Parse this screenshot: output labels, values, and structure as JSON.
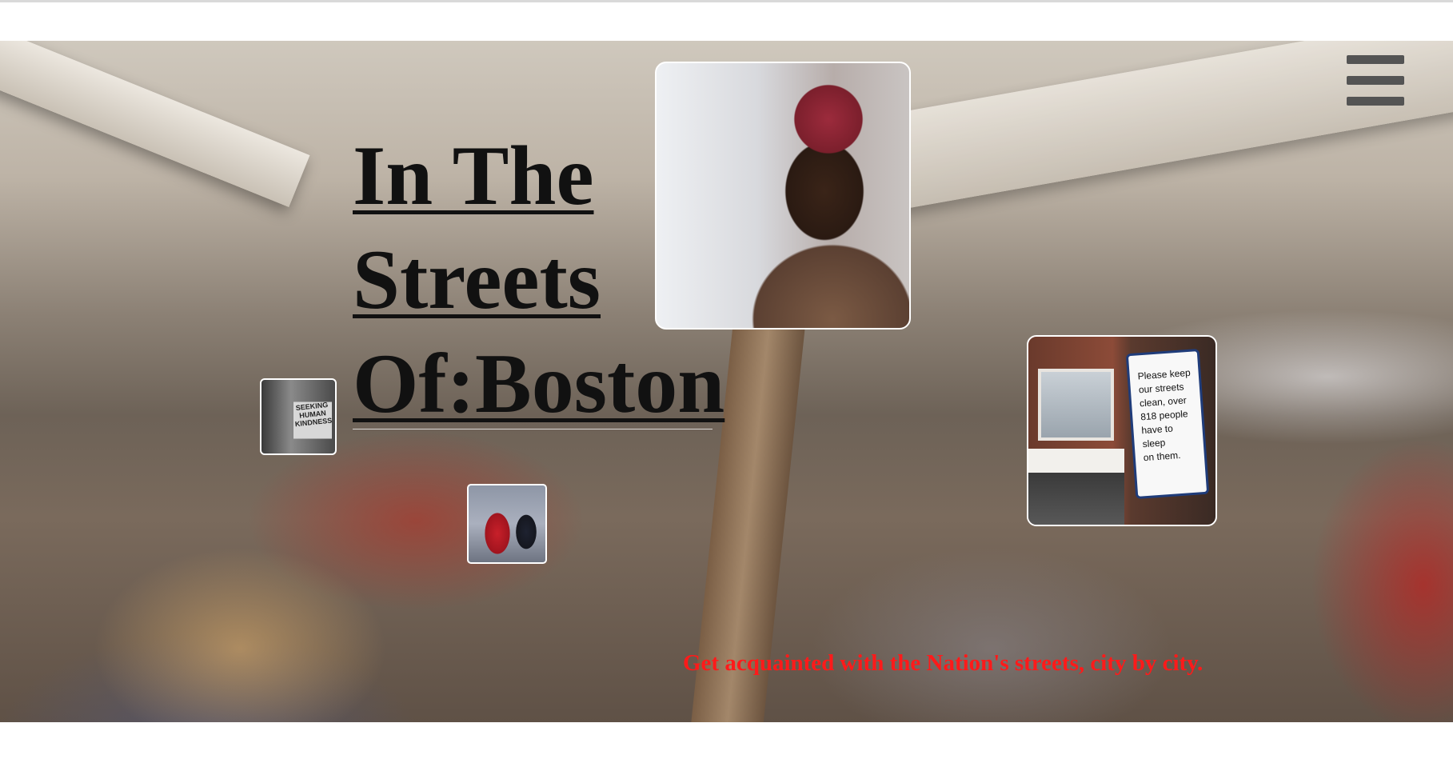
{
  "header": {
    "menu_icon": "hamburger-menu-icon"
  },
  "hero": {
    "title_line1": "In The",
    "title_line2": "Streets",
    "title_line3": "Of:Boston",
    "tagline": "Get acquainted with the Nation's streets, city by city.",
    "sign_photo_text": "SEEKING HUMAN KINDNESS",
    "placard_line1": "Please keep",
    "placard_line2": "our streets",
    "placard_line3": "clean, over",
    "placard_line4": "818 people",
    "placard_line5": "have to sleep",
    "placard_line6": "on them."
  },
  "colors": {
    "tagline": "#ff1a1a",
    "title": "#111111",
    "menu_icon": "#545454"
  }
}
